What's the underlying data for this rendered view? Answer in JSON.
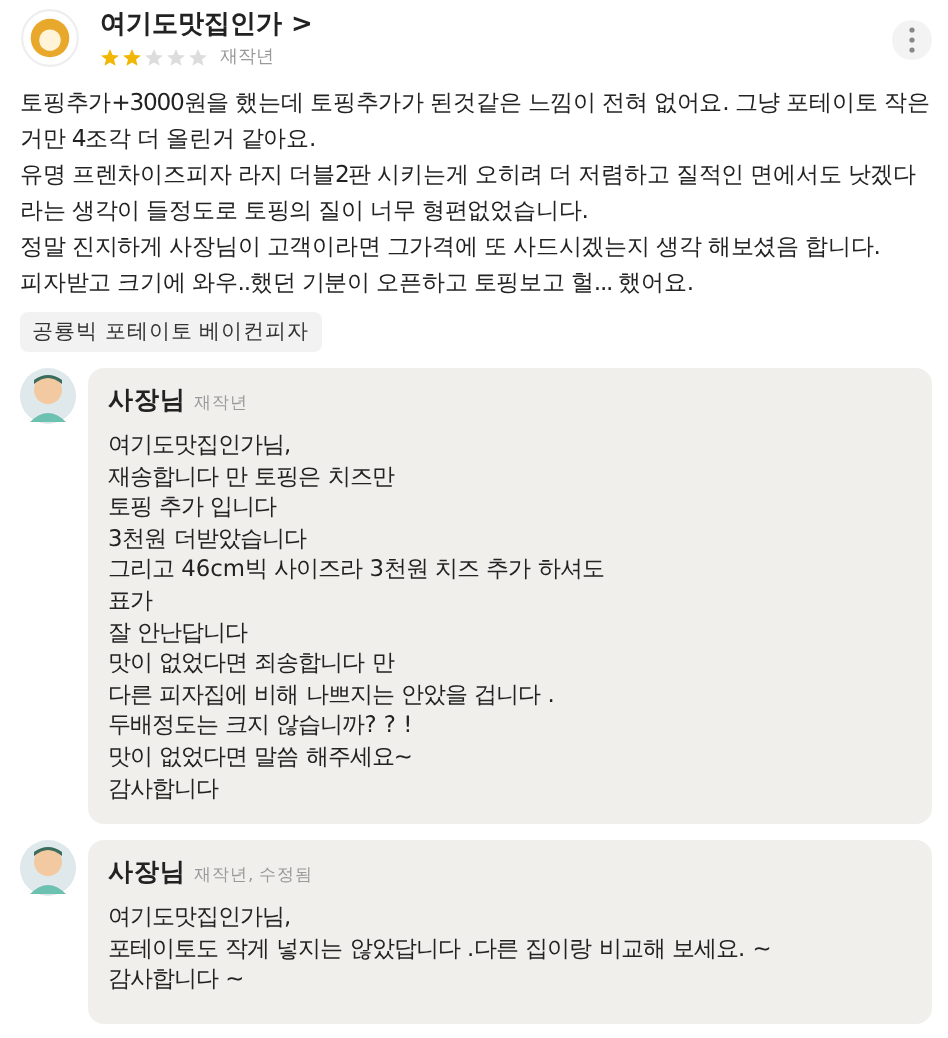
{
  "review": {
    "author": "여기도맛집인가 >",
    "stars": 2,
    "time": "재작년",
    "paragraphs": [
      "토핑추가+3000원을 했는데 토핑추가가 된것같은 느낌이 전혀 없어요. 그냥 포테이토 작은거만 4조각 더 올린거 같아요.",
      "유명 프렌차이즈피자 라지 더블2판 시키는게 오히려 더 저렴하고 질적인 면에서도 낫겠다라는 생각이 들정도로 토핑의 질이 너무 형편없었습니다.",
      "정말 진지하게 사장님이 고객이라면 그가격에 또 사드시겠는지 생각 해보셨음 합니다.",
      "피자받고 크기에 와우..했던 기분이 오픈하고 토핑보고 헐... 했어요."
    ],
    "menu_tag": "공룡빅 포테이토 베이컨피자"
  },
  "replies": [
    {
      "author": "사장님",
      "time": "재작년",
      "lines": [
        "여기도맛집인가님,",
        "재송합니다 만 토핑은 치즈만",
        "토핑 추가 입니다",
        "3천원 더받았습니다",
        "그리고 46cm빅 사이즈라 3천원 치즈 추가 하셔도",
        "표가",
        "잘 안난답니다",
        "맛이 없었다면 죄송합니다 만",
        "다른 피자집에 비해 나쁘지는 안았을 겁니다 .",
        "두배정도는 크지 않습니까? ? !",
        "맛이 없었다면 말씀 해주세요~",
        "감사합니다"
      ]
    },
    {
      "author": "사장님",
      "time": "재작년, 수정됨",
      "lines": [
        "여기도맛집인가님,",
        "포테이토도 작게 넣지는 않았답니다 .다른 집이랑 비교해 보세요. ~",
        "감사합니다 ~"
      ]
    }
  ]
}
